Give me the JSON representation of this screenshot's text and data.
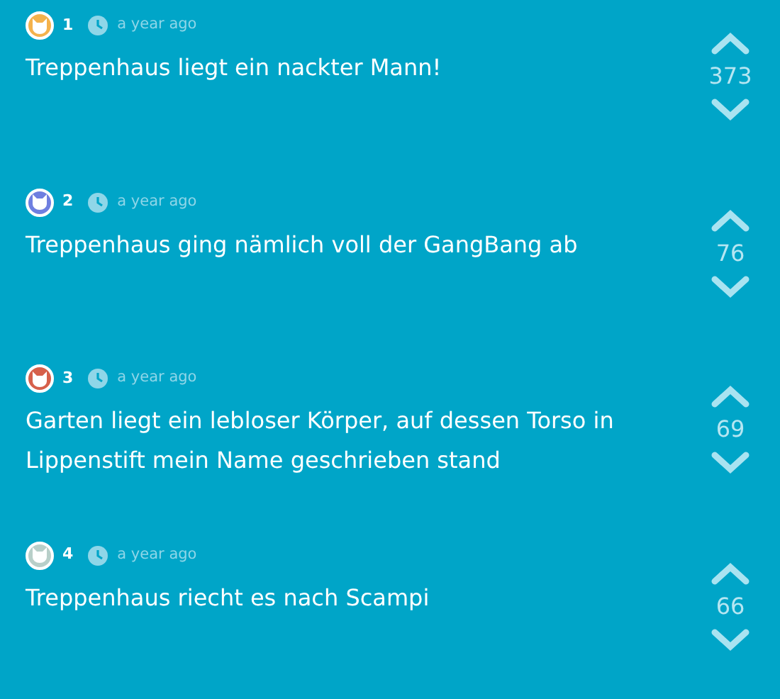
{
  "posts": [
    {
      "number": "1",
      "color": "#f4b24c",
      "time": "a year ago",
      "text": "Treppenhaus liegt ein nackter Mann!",
      "votes": "373"
    },
    {
      "number": "2",
      "color": "#6f7fe0",
      "time": "a year ago",
      "text": "Treppenhaus ging nämlich voll der GangBang ab",
      "votes": "76"
    },
    {
      "number": "3",
      "color": "#d6604b",
      "time": "a year ago",
      "text": "Garten liegt ein lebloser Körper, auf dessen Torso in Lippenstift mein Name geschrieben stand",
      "votes": "69"
    },
    {
      "number": "4",
      "color": "#b8cfc9",
      "time": "a year ago",
      "text": "Treppenhaus riecht es nach Scampi",
      "votes": "66"
    }
  ]
}
